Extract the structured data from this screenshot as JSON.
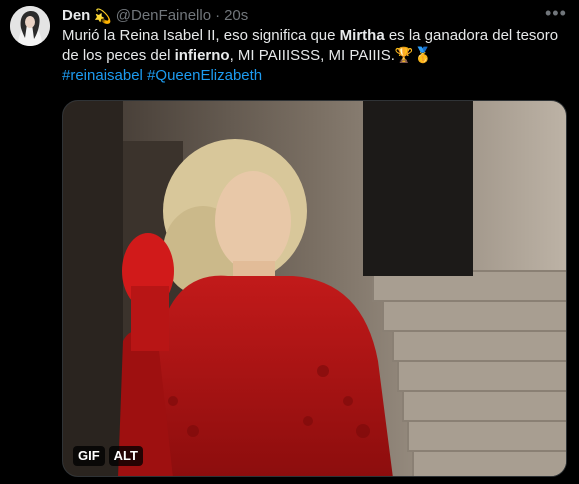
{
  "tweet": {
    "author_name": "Den",
    "author_emoji": "💫",
    "author_handle": "@DenFainello",
    "separator": "·",
    "timestamp": "20s",
    "more_label": "•••",
    "text_part1": "Murió la Reina Isabel II, eso significa que ",
    "text_bold1": "Mirtha",
    "text_part2": " es la ganadora del tesoro de los peces del ",
    "text_bold2": "infierno",
    "text_part3": ", MI PAIIISSS, MI PAIIIS.",
    "text_emojis": "🏆🥇",
    "hashtag1": "#reinaisabel",
    "hashtag2": "#QueenElizabeth"
  },
  "media": {
    "gif_badge": "GIF",
    "alt_badge": "ALT"
  },
  "colors": {
    "background": "#000000",
    "text": "#e7e9ea",
    "secondary": "#71767b",
    "link": "#1d9bf0"
  }
}
